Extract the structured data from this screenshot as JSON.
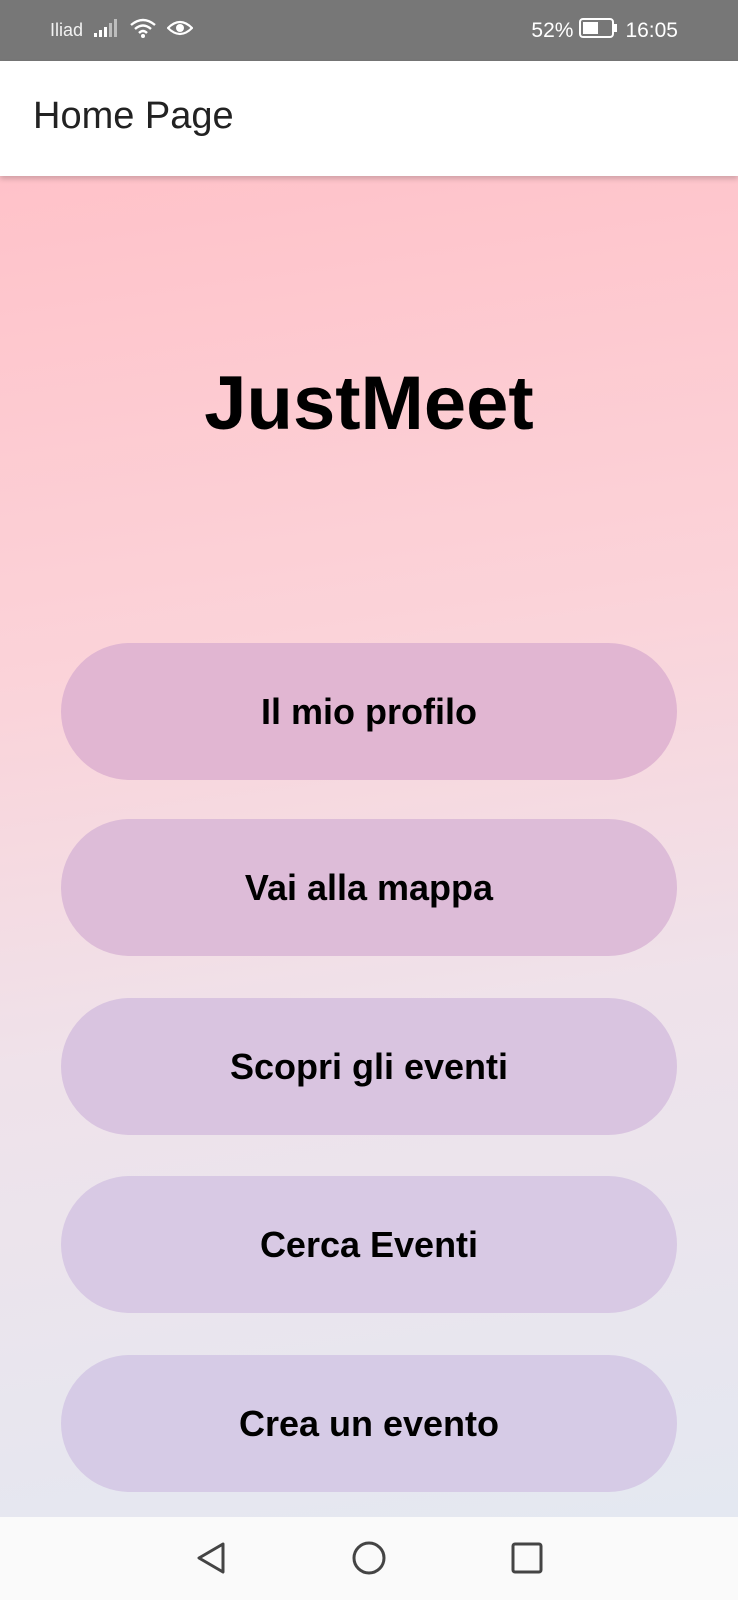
{
  "status_bar": {
    "carrier": "Iliad",
    "battery": "52%",
    "time": "16:05"
  },
  "app_bar": {
    "title": "Home Page"
  },
  "main": {
    "app_name": "JustMeet",
    "buttons": [
      {
        "label": "Il mio profilo"
      },
      {
        "label": "Vai alla mappa"
      },
      {
        "label": "Scopri gli eventi"
      },
      {
        "label": "Cerca Eventi"
      },
      {
        "label": "Crea un evento"
      }
    ]
  },
  "nav_bar": {
    "icons": [
      "back-icon",
      "home-icon",
      "recents-icon"
    ]
  },
  "colors": {
    "status_bar_bg": "#777777",
    "button_colors": [
      "#e1b6d2",
      "#ddbcd8",
      "#d9c4e0",
      "#d8c9e4",
      "#d6cbe6"
    ]
  }
}
